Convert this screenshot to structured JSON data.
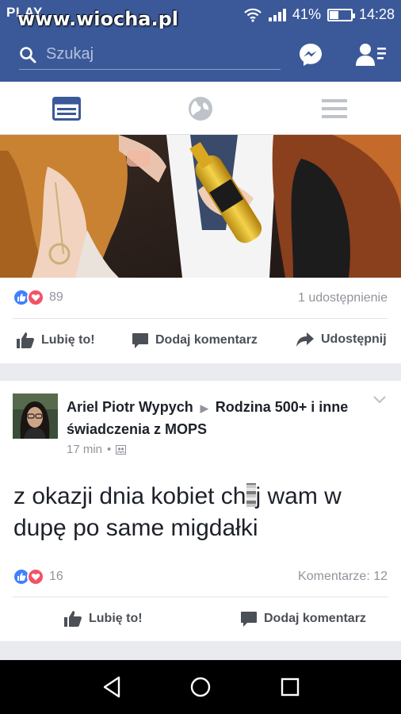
{
  "status_bar": {
    "carrier": "PLAY",
    "watermark": "www.wiocha.pl",
    "battery": "41%",
    "battery_level": 0.41,
    "time": "14:28"
  },
  "header": {
    "search_placeholder": "Szukaj",
    "icons": [
      "search-icon",
      "messenger-icon",
      "friend-requests-icon"
    ]
  },
  "tabs": [
    {
      "name": "news-feed",
      "icon": "news-feed-icon",
      "active": true
    },
    {
      "name": "notifications",
      "icon": "globe-icon",
      "active": false
    },
    {
      "name": "menu",
      "icon": "hamburger-icon",
      "active": false
    }
  ],
  "post1": {
    "reaction_count": "89",
    "shares": "1 udostępnienie",
    "actions": {
      "like": "Lubię to!",
      "comment": "Dodaj komentarz",
      "share": "Udostępnij"
    }
  },
  "post2": {
    "author": "Ariel Piotr Wypych",
    "group": "Rodzina 500+ i inne świadczenia z MOPS",
    "time": "17 min",
    "text": "z okazji dnia kobiet ch",
    "text_rest": "j wam w dupę po same migdałki",
    "reaction_count": "16",
    "comments": "Komentarze: 12",
    "actions": {
      "like": "Lubię to!",
      "comment": "Dodaj komentarz"
    }
  },
  "colors": {
    "brand": "#3b5998",
    "like": "#4080ff",
    "love": "#f25268",
    "muted": "#90949c"
  }
}
